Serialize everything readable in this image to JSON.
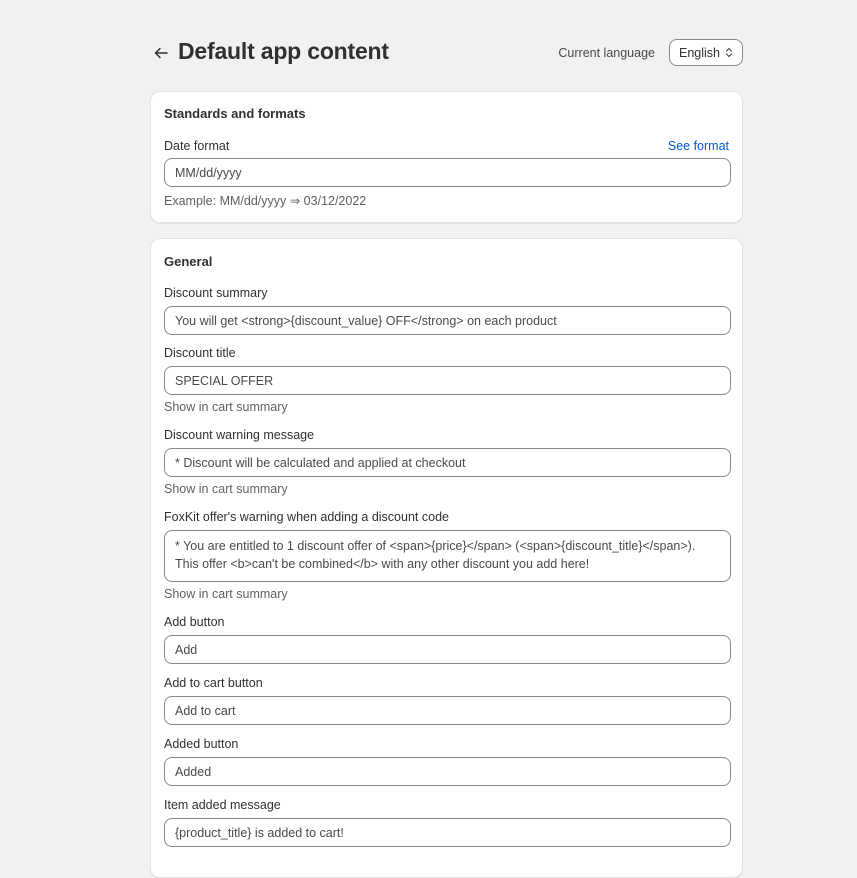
{
  "header": {
    "title": "Default app content",
    "current_language_label": "Current language",
    "language_value": "English"
  },
  "standards": {
    "title": "Standards and formats",
    "date_format_label": "Date format",
    "see_format_link": "See format",
    "date_format_value": "MM/dd/yyyy",
    "example_text": "Example: MM/dd/yyyy ⇒ 03/12/2022"
  },
  "general": {
    "title": "General",
    "discount_summary": {
      "label": "Discount summary",
      "value": "You will get <strong>{discount_value} OFF</strong> on each product"
    },
    "discount_title": {
      "label": "Discount title",
      "value": "SPECIAL OFFER",
      "help": "Show in cart summary"
    },
    "discount_warning": {
      "label": "Discount warning message",
      "value": "* Discount will be calculated and applied at checkout",
      "help": "Show in cart summary"
    },
    "foxkit_warning": {
      "label": "FoxKit offer's warning when adding a discount code",
      "value": "* You are entitled to 1 discount offer of <span>{price}</span> (<span>{discount_title}</span>). This offer <b>can't be combined</b> with any other discount you add here!",
      "help": "Show in cart summary"
    },
    "add_button": {
      "label": "Add button",
      "value": "Add"
    },
    "add_to_cart_button": {
      "label": "Add to cart button",
      "value": "Add to cart"
    },
    "added_button": {
      "label": "Added button",
      "value": "Added"
    },
    "item_added_message": {
      "label": "Item added message",
      "value": "{product_title} is added to cart!"
    }
  }
}
